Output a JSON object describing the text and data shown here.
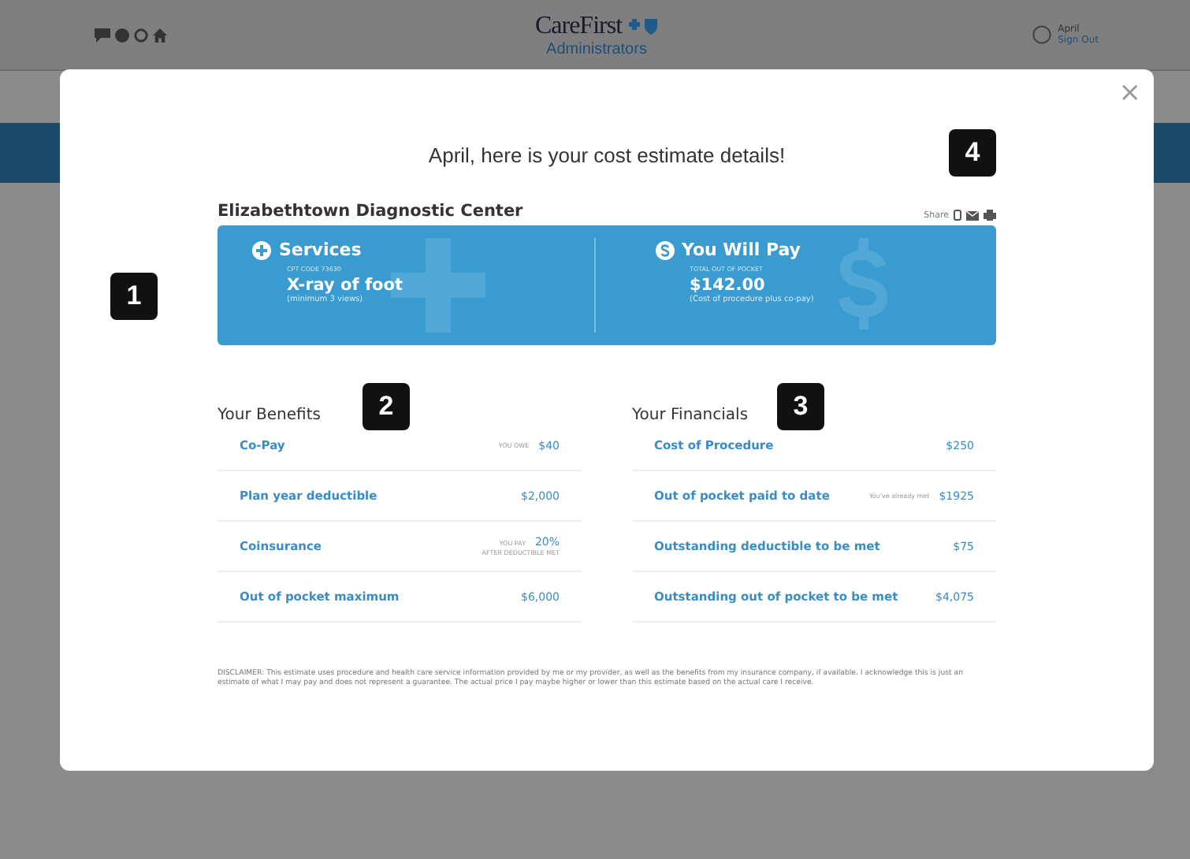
{
  "header": {
    "logo_top": "CareFirst",
    "logo_bottom": "Administrators",
    "user_name": "April",
    "sign_out": "Sign Out"
  },
  "modal": {
    "close": "×",
    "title": "April, here is your cost estimate details!",
    "provider": "Elizabethtown Diagnostic Center",
    "share_label": "Share",
    "summary": [
      {
        "kind": "plus",
        "heading": "Services",
        "caption": "CPT CODE 73630",
        "value": "X-ray of foot",
        "note": "(minimum 3 views)"
      },
      {
        "kind": "dollar",
        "heading": "You Will Pay",
        "caption": "TOTAL OUT OF POCKET",
        "value": "$142.00",
        "note": "(Cost of procedure plus co-pay)"
      }
    ],
    "sections": [
      {
        "title": "Your Benefits",
        "rows": [
          {
            "label": "Co-Pay",
            "hint": "YOU OWE",
            "value": "$40"
          },
          {
            "label": "Plan year deductible",
            "value": "$2,000"
          },
          {
            "label": "Coinsurance",
            "hint": "YOU PAY",
            "value": "20%",
            "sub": "AFTER DEDUCTIBLE MET"
          },
          {
            "label": "Out of pocket maximum",
            "value": "$6,000"
          }
        ]
      },
      {
        "title": "Your Financials",
        "rows": [
          {
            "label": "Cost of Procedure",
            "value": "$250"
          },
          {
            "label": "Out of pocket paid to date",
            "hint": "You've already met",
            "value": "$1925"
          },
          {
            "label": "Outstanding deductible to be met",
            "value": "$75"
          },
          {
            "label": "Outstanding out of pocket to be met",
            "value": "$4,075"
          }
        ]
      }
    ],
    "disclaimer": "DISCLAIMER: This estimate uses procedure and health care service information provided by me or my provider, as well as the benefits from my insurance company, if available. I acknowledge this is just an estimate of what I may pay and does not represent a guarantee. The actual price I pay maybe higher or lower than this estimate based on the actual care I receive."
  },
  "callouts": [
    "1",
    "2",
    "3",
    "4"
  ]
}
